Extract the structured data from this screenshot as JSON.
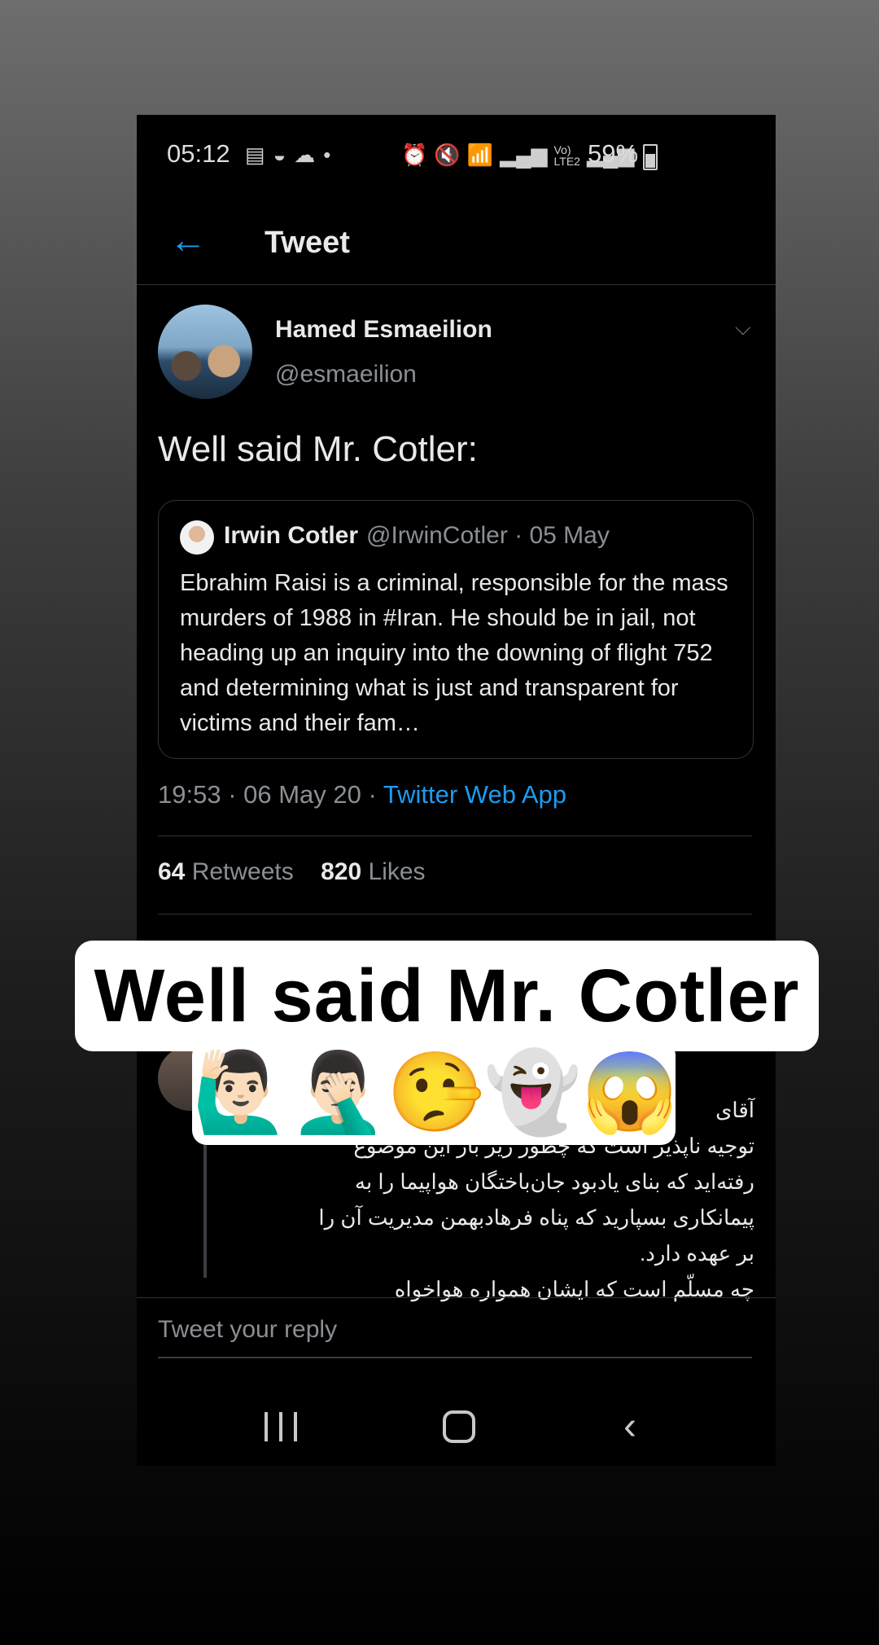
{
  "status": {
    "time": "05:12",
    "battery": "59%",
    "icons_left": [
      "calendar-icon",
      "basket-icon",
      "cloud-icon",
      "dot-icon"
    ],
    "icons_right": [
      "alarm-icon",
      "mute-icon",
      "wifi-icon",
      "signal-icon",
      "volte-lte2-icon",
      "signal-icon"
    ]
  },
  "header": {
    "title": "Tweet",
    "back_icon": "arrow-left-icon"
  },
  "tweet": {
    "author_name": "Hamed Esmaeilion",
    "author_handle": "@esmaeilion",
    "text": "Well said Mr. Cotler:",
    "timestamp": "19:53 · 06 May 20 · ",
    "source_app": "Twitter Web App",
    "retweets_count": "64",
    "retweets_label": " Retweets",
    "likes_count": "820",
    "likes_label": " Likes"
  },
  "quote": {
    "name": "Irwin Cotler",
    "meta": "@IrwinCotler · 05 May",
    "body": "Ebrahim Raisi is a criminal, responsible for the mass murders of 1988 in #Iran. He should be in jail, not heading up an inquiry into the downing of flight 752 and determining what is just and transparent for victims and their fam…"
  },
  "reply_preview": {
    "lines": [
      "آقای",
      "توجیه ناپذیر است که چطور زیر بار این موضوع",
      "رفته‌اید که بنای یادبود جان‌باختگان هواپیما را به",
      "پیمانکاری بسپارید که پناه فرهادبهمن مدیریت آن را",
      "بر عهده دارد.",
      "چه مسلّم است که ایشان همواره هواخواه"
    ]
  },
  "reply_box": {
    "placeholder": "Tweet your reply"
  },
  "overlay": {
    "caption": "Well said Mr. Cotler",
    "emojis": [
      "🙋🏻‍♂️",
      "🤦🏻‍♂️",
      "🤥",
      "👻",
      "😱"
    ]
  }
}
